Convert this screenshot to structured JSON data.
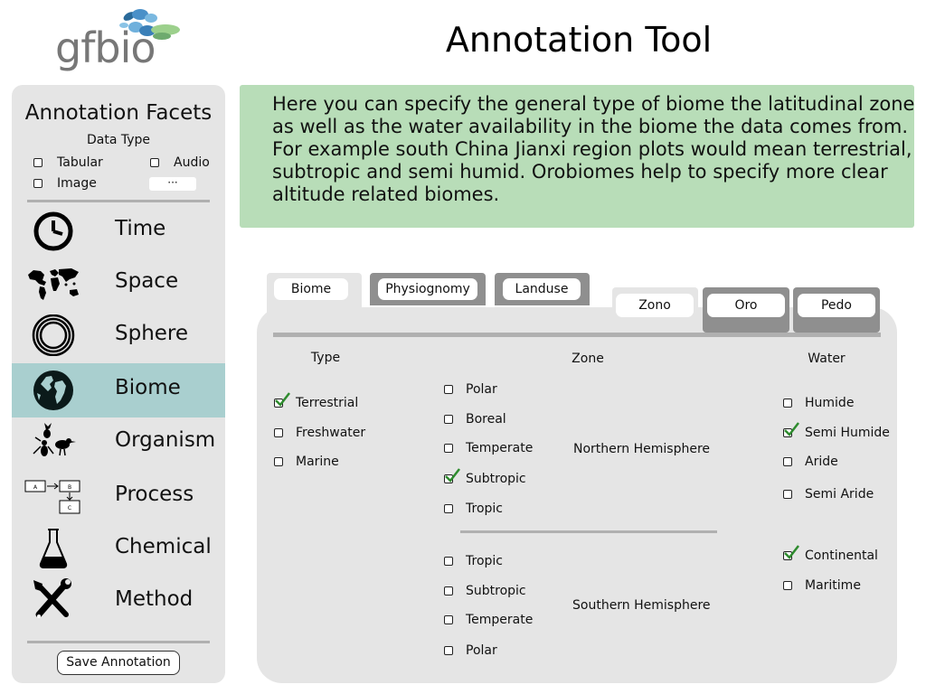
{
  "app": {
    "logo_text": "gfbio",
    "title": "Annotation Tool"
  },
  "sidebar": {
    "title": "Annotation Facets",
    "data_type": {
      "label": "Data Type",
      "options": [
        {
          "label": "Tabular",
          "checked": false
        },
        {
          "label": "Audio",
          "checked": false
        },
        {
          "label": "Image",
          "checked": false
        }
      ],
      "more_label": "···"
    },
    "items": [
      {
        "label": "Time",
        "icon": "clock-icon",
        "active": false
      },
      {
        "label": "Space",
        "icon": "world-map-icon",
        "active": false
      },
      {
        "label": "Sphere",
        "icon": "sphere-icon",
        "active": false
      },
      {
        "label": "Biome",
        "icon": "globe-icon",
        "active": true
      },
      {
        "label": "Organism",
        "icon": "organism-icon",
        "active": false
      },
      {
        "label": "Process",
        "icon": "process-diagram-icon",
        "active": false
      },
      {
        "label": "Chemical",
        "icon": "flask-icon",
        "active": false
      },
      {
        "label": "Method",
        "icon": "tools-icon",
        "active": false
      }
    ],
    "save_label": "Save Annotation",
    "process_icon_labels": [
      "A",
      "B",
      "C"
    ]
  },
  "description": "Here you can specify the general type of biome the latitudinal zone as well as the water availability in the biome the data comes from. For example south China Jianxi region plots would mean terrestrial, subtropic and semi humid. Orobiomes help to specify more clear altitude related biomes.",
  "tabs": {
    "main": [
      {
        "label": "Biome",
        "active": true
      },
      {
        "label": "Physiognomy",
        "active": false
      },
      {
        "label": "Landuse",
        "active": false
      }
    ],
    "sub": [
      {
        "label": "Zono",
        "active": true
      },
      {
        "label": "Oro",
        "active": false
      },
      {
        "label": "Pedo",
        "active": false
      }
    ]
  },
  "biome": {
    "type": {
      "header": "Type",
      "options": [
        {
          "label": "Terrestrial",
          "checked": true
        },
        {
          "label": "Freshwater",
          "checked": false
        },
        {
          "label": "Marine",
          "checked": false
        }
      ]
    },
    "zone": {
      "header": "Zone",
      "northern": {
        "label": "Northern Hemisphere",
        "options": [
          {
            "label": "Polar",
            "checked": false
          },
          {
            "label": "Boreal",
            "checked": false
          },
          {
            "label": "Temperate",
            "checked": false
          },
          {
            "label": "Subtropic",
            "checked": true
          },
          {
            "label": "Tropic",
            "checked": false
          }
        ]
      },
      "southern": {
        "label": "Southern Hemisphere",
        "options": [
          {
            "label": "Tropic",
            "checked": false
          },
          {
            "label": "Subtropic",
            "checked": false
          },
          {
            "label": "Temperate",
            "checked": false
          },
          {
            "label": "Polar",
            "checked": false
          }
        ]
      }
    },
    "water": {
      "header": "Water",
      "humidity": [
        {
          "label": "Humide",
          "checked": false
        },
        {
          "label": "Semi Humide",
          "checked": true
        },
        {
          "label": "Aride",
          "checked": false
        },
        {
          "label": "Semi Aride",
          "checked": false
        }
      ],
      "climate": [
        {
          "label": "Continental",
          "checked": true
        },
        {
          "label": "Maritime",
          "checked": false
        }
      ]
    }
  },
  "colors": {
    "description_bg": "#b8ddb8",
    "active_nav_bg": "#a9cfcf",
    "panel_bg": "#e5e5e5",
    "check_green": "#2e8b2e",
    "tab_inactive": "#8f8f8f"
  }
}
